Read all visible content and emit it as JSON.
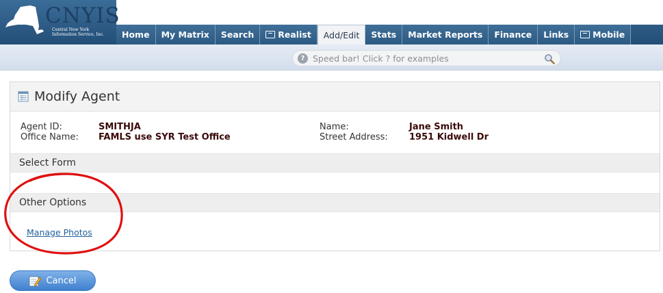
{
  "header": {
    "logo_text": "CNYIS",
    "logo_subtitle": "Central New York Information Service, Inc.",
    "nav": [
      {
        "label": "Home",
        "external": false,
        "active": false
      },
      {
        "label": "My Matrix",
        "external": false,
        "active": false
      },
      {
        "label": "Search",
        "external": false,
        "active": false
      },
      {
        "label": "Realist",
        "external": true,
        "active": false
      },
      {
        "label": "Add/Edit",
        "external": false,
        "active": true
      },
      {
        "label": "Stats",
        "external": false,
        "active": false
      },
      {
        "label": "Market Reports",
        "external": false,
        "active": false
      },
      {
        "label": "Finance",
        "external": false,
        "active": false
      },
      {
        "label": "Links",
        "external": false,
        "active": false
      },
      {
        "label": "Mobile",
        "external": true,
        "active": false
      }
    ]
  },
  "speedbar": {
    "placeholder": "Speed bar! Click ? for examples",
    "help_glyph": "?"
  },
  "page": {
    "title": "Modify Agent",
    "agent_id_label": "Agent ID:",
    "agent_id": "SMITHJA",
    "office_label": "Office Name:",
    "office": "FAMLS use SYR Test Office",
    "name_label": "Name:",
    "name": "Jane Smith",
    "address_label": "Street Address:",
    "address": "1951 Kidwell Dr",
    "select_form": "Select Form",
    "other_options": "Other Options",
    "manage_photos": "Manage Photos"
  },
  "actions": {
    "cancel": "Cancel"
  },
  "colors": {
    "nav_blue": "#2c5a83",
    "value_text": "#3b0a0a",
    "link": "#1f5f98",
    "annotation": "#e01010",
    "button_blue": "#3f80cf"
  }
}
